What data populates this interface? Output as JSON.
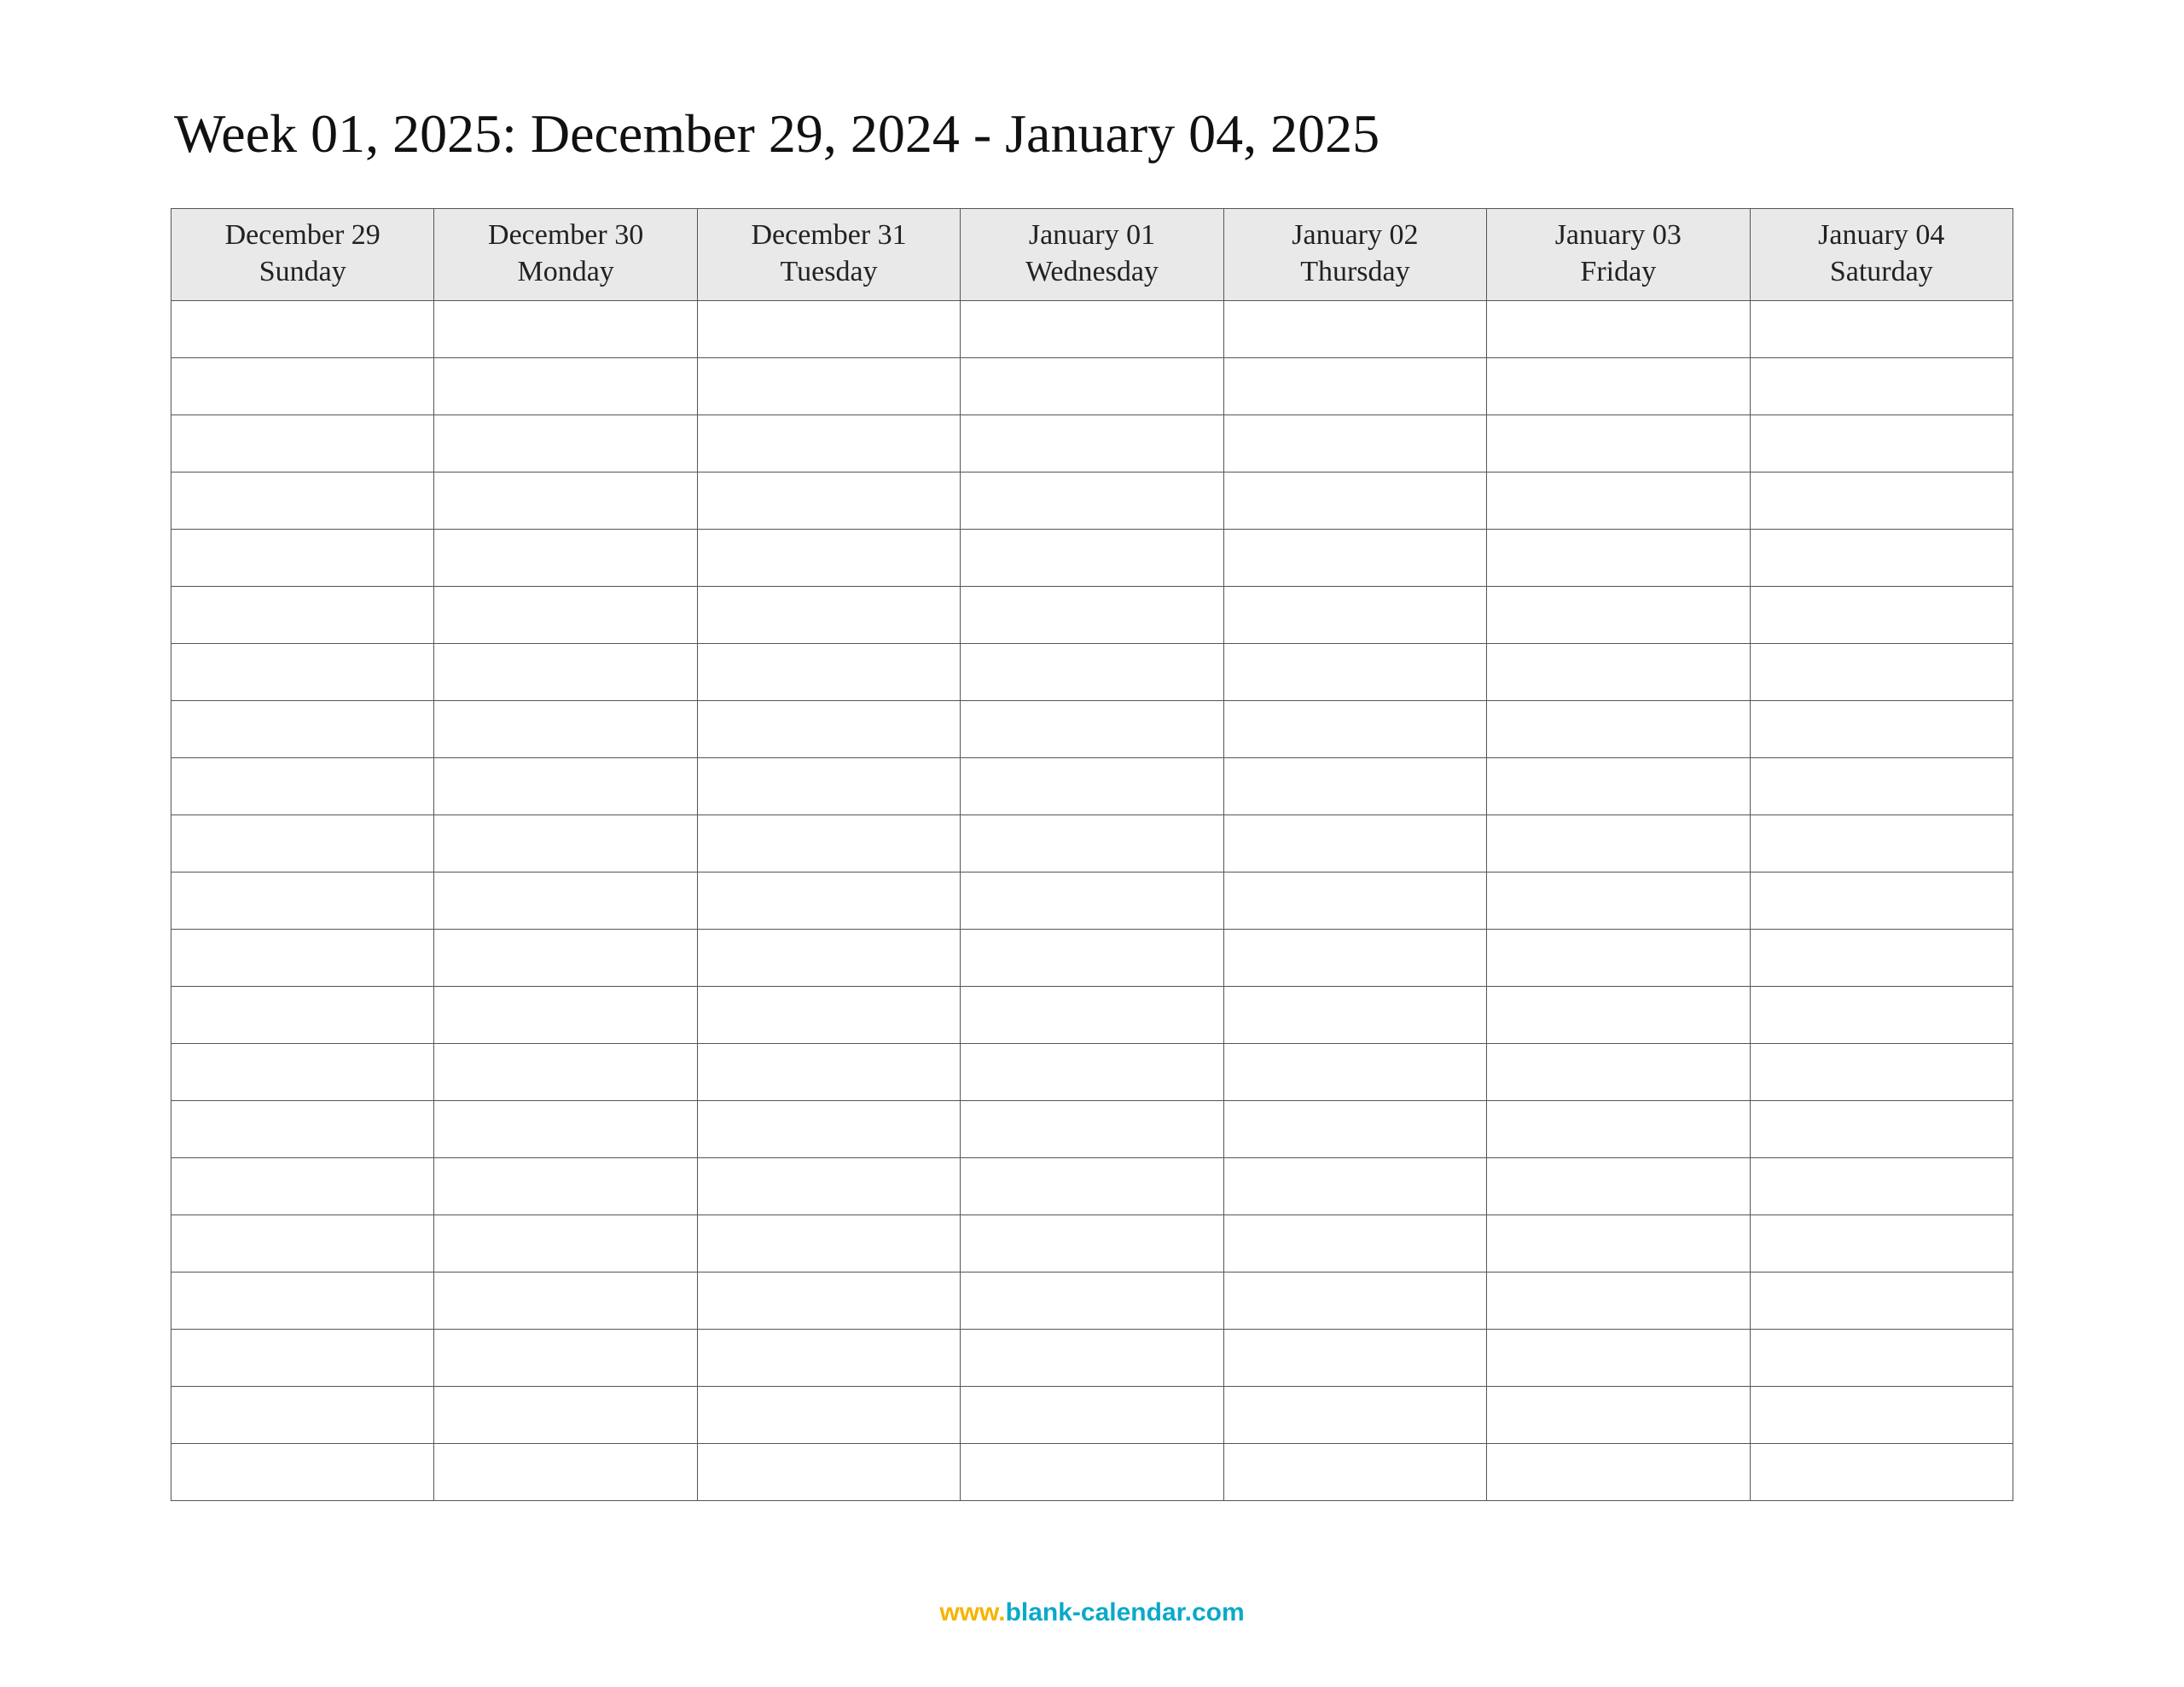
{
  "title": "Week 01, 2025: December 29, 2024 - January 04, 2025",
  "columns": [
    {
      "date": "December 29",
      "day": "Sunday"
    },
    {
      "date": "December 30",
      "day": "Monday"
    },
    {
      "date": "December 31",
      "day": "Tuesday"
    },
    {
      "date": "January 01",
      "day": "Wednesday"
    },
    {
      "date": "January 02",
      "day": "Thursday"
    },
    {
      "date": "January 03",
      "day": "Friday"
    },
    {
      "date": "January 04",
      "day": "Saturday"
    }
  ],
  "blank_row_count": 21,
  "footer": {
    "www": "www.",
    "domain": "blank-calendar.com"
  }
}
